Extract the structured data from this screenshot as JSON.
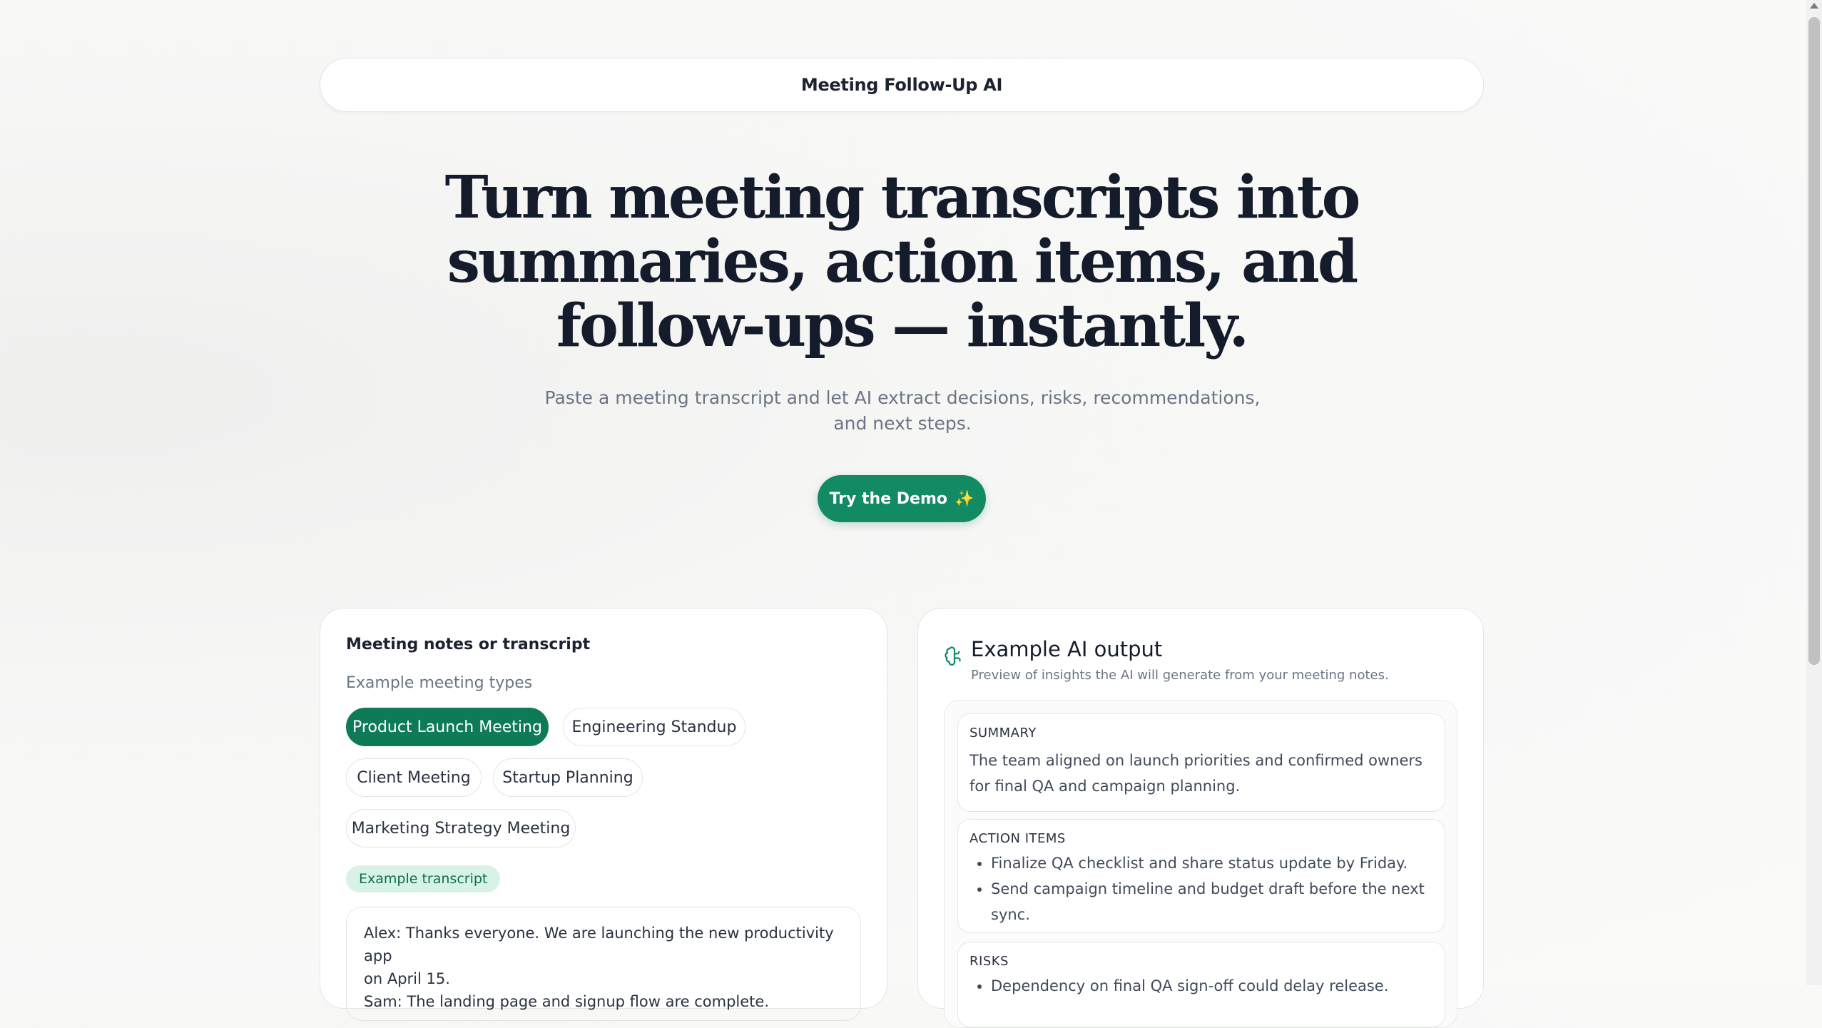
{
  "nav": {
    "brand": "Meeting Follow-Up AI"
  },
  "hero": {
    "title_lines": [
      "Turn meeting transcripts into",
      "summaries, action items, and",
      "follow-ups — instantly."
    ],
    "subtitle": "Paste a meeting transcript and let AI extract decisions, risks, recommendations, and next steps.",
    "cta_label": "Try the Demo",
    "cta_icon": "sparkles-icon"
  },
  "input_card": {
    "label": "Meeting notes or transcript",
    "types_label": "Example meeting types",
    "meeting_types": [
      {
        "label": "Product Launch Meeting",
        "active": true
      },
      {
        "label": "Engineering Standup",
        "active": false
      },
      {
        "label": "Client Meeting",
        "active": false
      },
      {
        "label": "Startup Planning",
        "active": false
      },
      {
        "label": "Marketing Strategy Meeting",
        "active": false
      }
    ],
    "badge": "Example transcript",
    "transcript_lines": [
      "Alex: Thanks everyone. We are launching the new productivity app",
      "on April 15.",
      "Sam: The landing page and signup flow are complete."
    ]
  },
  "output_card": {
    "icon": "brain-icon",
    "title": "Example AI output",
    "subtitle": "Preview of insights the AI will generate from your meeting notes.",
    "summary": {
      "label": "SUMMARY",
      "text": "The team aligned on launch priorities and confirmed owners for final QA and campaign planning."
    },
    "action_items": {
      "label": "ACTION ITEMS",
      "items": [
        "Finalize QA checklist and share status update by Friday.",
        "Send campaign timeline and budget draft before the next sync."
      ]
    },
    "risks": {
      "label": "RISKS",
      "items": [
        "Dependency on final QA sign-off could delay release."
      ]
    }
  },
  "colors": {
    "accent": "#128a63",
    "accent_dark": "#0f7a58",
    "badge_bg": "#d8f3e6",
    "title": "#141b2b",
    "muted": "#6b7485"
  }
}
